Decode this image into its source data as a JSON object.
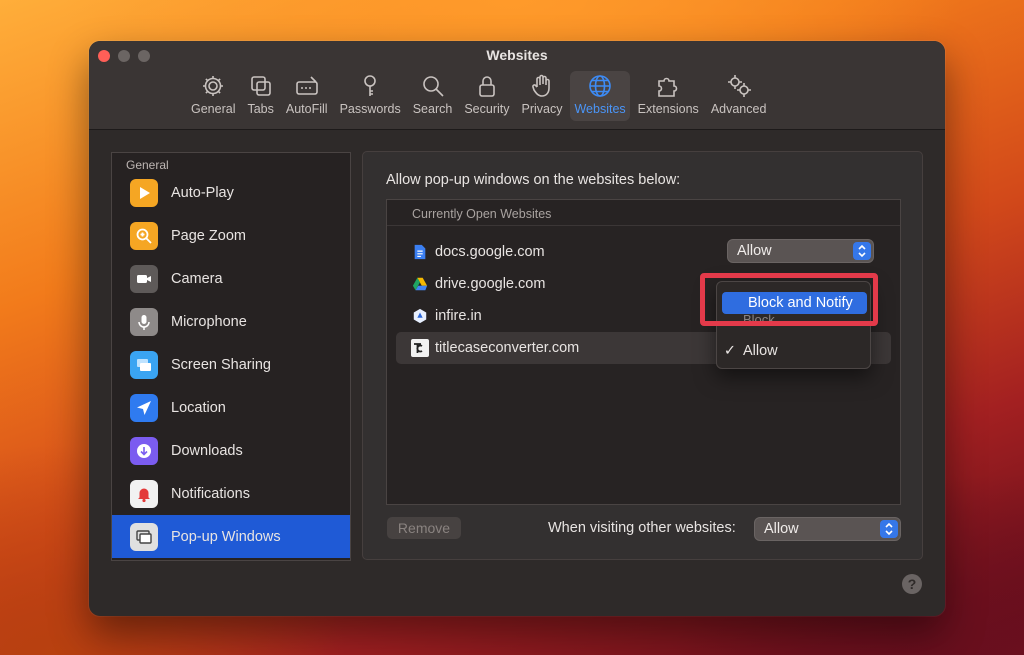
{
  "window": {
    "title": "Websites"
  },
  "toolbar": {
    "items": [
      {
        "label": "General",
        "icon": "gear-icon"
      },
      {
        "label": "Tabs",
        "icon": "tabs-icon"
      },
      {
        "label": "AutoFill",
        "icon": "autofill-icon"
      },
      {
        "label": "Passwords",
        "icon": "key-icon"
      },
      {
        "label": "Search",
        "icon": "search-icon"
      },
      {
        "label": "Security",
        "icon": "lock-icon"
      },
      {
        "label": "Privacy",
        "icon": "hand-icon"
      },
      {
        "label": "Websites",
        "icon": "globe-icon",
        "active": true
      },
      {
        "label": "Extensions",
        "icon": "puzzle-icon"
      },
      {
        "label": "Advanced",
        "icon": "gears-icon"
      }
    ]
  },
  "sidebar": {
    "header": "General",
    "items": [
      {
        "label": "Auto-Play",
        "icon": "play-icon",
        "color": "#f5a623"
      },
      {
        "label": "Page Zoom",
        "icon": "zoom-icon",
        "color": "#f5a623"
      },
      {
        "label": "Camera",
        "icon": "camera-icon",
        "color": "#5e5a59"
      },
      {
        "label": "Microphone",
        "icon": "microphone-icon",
        "color": "#8e8a89"
      },
      {
        "label": "Screen Sharing",
        "icon": "screen-sharing-icon",
        "color": "#3aa4f2"
      },
      {
        "label": "Location",
        "icon": "location-arrow-icon",
        "color": "#2f7bf0"
      },
      {
        "label": "Downloads",
        "icon": "download-icon",
        "color": "#7b5cf0"
      },
      {
        "label": "Notifications",
        "icon": "bell-icon",
        "color": "#f2f2f2"
      },
      {
        "label": "Pop-up Windows",
        "icon": "popup-windows-icon",
        "color": "#e0e0e0",
        "selected": true
      }
    ]
  },
  "content": {
    "prompt": "Allow pop-up windows on the websites below:",
    "list_header": "Currently Open Websites",
    "sites": [
      {
        "name": "docs.google.com",
        "icon": "google-docs-icon",
        "setting": "Allow"
      },
      {
        "name": "drive.google.com",
        "icon": "google-drive-icon"
      },
      {
        "name": "infire.in",
        "icon": "infire-icon"
      },
      {
        "name": "titlecaseconverter.com",
        "icon": "titlecase-icon"
      }
    ],
    "menu": {
      "items": [
        {
          "label": "Block and Notify",
          "highlighted": true
        },
        {
          "label": "Block"
        },
        {
          "label": "Allow",
          "checked": true,
          "check": "✓"
        }
      ]
    },
    "remove_label": "Remove",
    "other_label": "When visiting other websites:",
    "other_setting": "Allow"
  },
  "help": {
    "label": "?"
  },
  "colors": {
    "accent": "#3577e9",
    "highlight_box": "#e33a4a",
    "selection": "#1f5ad6"
  }
}
